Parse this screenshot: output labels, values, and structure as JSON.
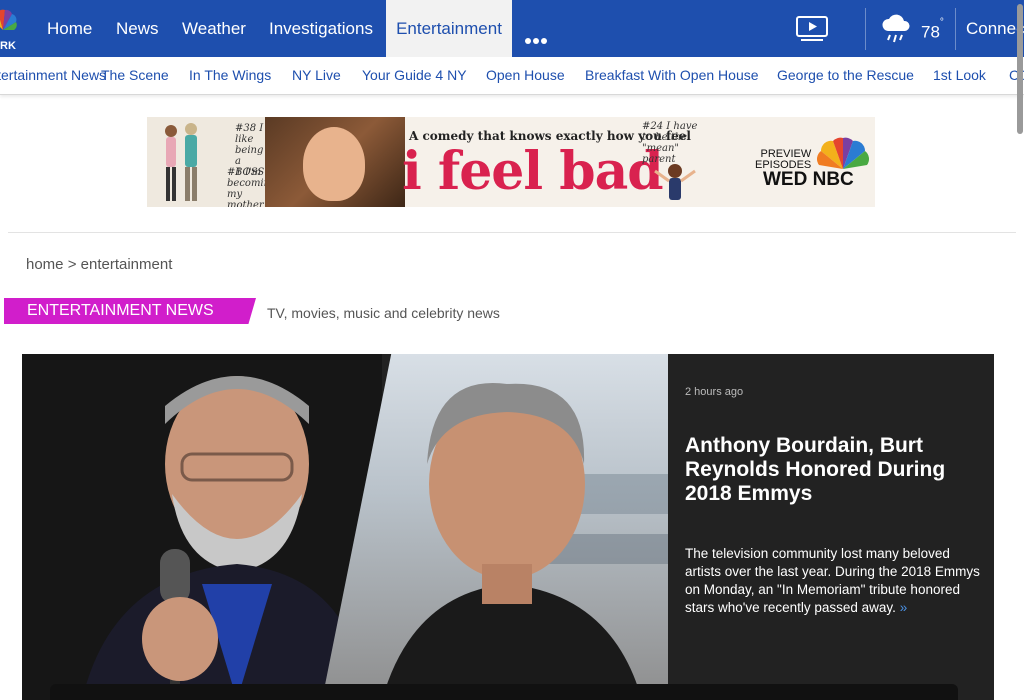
{
  "topnav": {
    "logo_text": "RK",
    "items": [
      {
        "label": "Home"
      },
      {
        "label": "News"
      },
      {
        "label": "Weather"
      },
      {
        "label": "Investigations"
      },
      {
        "label": "Entertainment",
        "active": true
      }
    ],
    "more_icon": "ellipsis-icon",
    "video_icon": "video-play-icon",
    "weather_icon": "rain-cloud-icon",
    "temperature": "78",
    "temperature_unit": "°",
    "connect_label": "Connect"
  },
  "subnav": {
    "items": [
      {
        "label": "Entertainment News"
      },
      {
        "label": "The Scene"
      },
      {
        "label": "In The Wings"
      },
      {
        "label": "NY Live"
      },
      {
        "label": "Your Guide 4 NY"
      },
      {
        "label": "Open House"
      },
      {
        "label": "Breakfast With Open House"
      },
      {
        "label": "George to the Rescue"
      },
      {
        "label": "1st Look"
      },
      {
        "label": "CO"
      }
    ]
  },
  "ad": {
    "tagline": "A comedy that knows exactly how you feel",
    "headline": "i feel bad",
    "note_1": "#38 I like being a BOSS",
    "note_2": "#1 I'm becoming my mother",
    "note_3": "#24 I have to be the \"mean\" parent",
    "preview_line_1": "PREVIEW",
    "preview_line_2": "EPISODES",
    "network": "WED NBC"
  },
  "breadcrumb": {
    "home": "home",
    "separator": " > ",
    "current": "entertainment"
  },
  "section": {
    "tag": "ENTERTAINMENT NEWS",
    "description": "TV, movies, music and celebrity news"
  },
  "hero": {
    "time": "2 hours ago",
    "title": "Anthony Bourdain, Burt Reynolds Honored During 2018 Emmys",
    "summary": "The television community lost many beloved artists over the last year. During the 2018 Emmys on Monday, an \"In Memoriam\" tribute honored stars who've recently passed away.",
    "more": "»"
  },
  "colors": {
    "brand_blue": "#1e4fae",
    "section_magenta": "#d11ecb",
    "ad_red": "#d9224f",
    "hero_panel": "#222222"
  }
}
